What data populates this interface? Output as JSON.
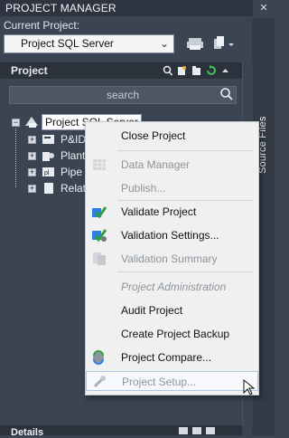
{
  "palette": {
    "title": "PROJECT MANAGER",
    "close_glyph": "✕"
  },
  "current_project": {
    "label": "Current Project:",
    "selected_value": "Project SQL Server",
    "dropdown_icon": "chevron-down-icon",
    "print_icon": "printer-icon",
    "copy_icon": "copy-icon"
  },
  "side_tab": {
    "label": "Source Files"
  },
  "project_panel": {
    "header": "Project",
    "header_icons": [
      "search-icon",
      "new-project-icon",
      "open-project-icon",
      "refresh-icon",
      "collapse-icon"
    ],
    "search_placeholder": "search"
  },
  "tree": {
    "root_label": "Project SQL Server",
    "children": [
      {
        "label": "P&ID",
        "icon": "pid-folder-icon"
      },
      {
        "label": "Plant",
        "icon": "plant-folder-icon"
      },
      {
        "label": "Pipe",
        "icon": "pipe-folder-icon"
      },
      {
        "label": "Relat",
        "icon": "related-files-icon"
      }
    ]
  },
  "context_menu": {
    "items": [
      {
        "label": "Close Project",
        "state": "enabled",
        "icon": ""
      },
      {
        "label": "Data Manager",
        "state": "disabled",
        "icon": "grid-icon"
      },
      {
        "label": "Publish...",
        "state": "disabled",
        "icon": ""
      },
      {
        "label": "Validate Project",
        "state": "enabled",
        "icon": "validate-icon"
      },
      {
        "label": "Validation Settings...",
        "state": "enabled",
        "icon": "validation-settings-icon"
      },
      {
        "label": "Validation Summary",
        "state": "disabled",
        "icon": "summary-icon"
      },
      {
        "label": "Project Administration",
        "state": "header",
        "icon": ""
      },
      {
        "label": "Audit Project",
        "state": "enabled",
        "icon": ""
      },
      {
        "label": "Create Project Backup",
        "state": "enabled",
        "icon": ""
      },
      {
        "label": "Project Compare...",
        "state": "enabled",
        "icon": "compare-icon"
      },
      {
        "label": "Project Setup...",
        "state": "hovered-disabled",
        "icon": "setup-wrench-icon"
      }
    ]
  },
  "details_panel": {
    "label": "Details"
  },
  "colors": {
    "panel_bg": "#3b4453",
    "menu_bg": "#f0f0f0",
    "menu_hover": "#a7c9e8",
    "accent_green": "#2ea043",
    "accent_blue": "#2f7fe0"
  }
}
